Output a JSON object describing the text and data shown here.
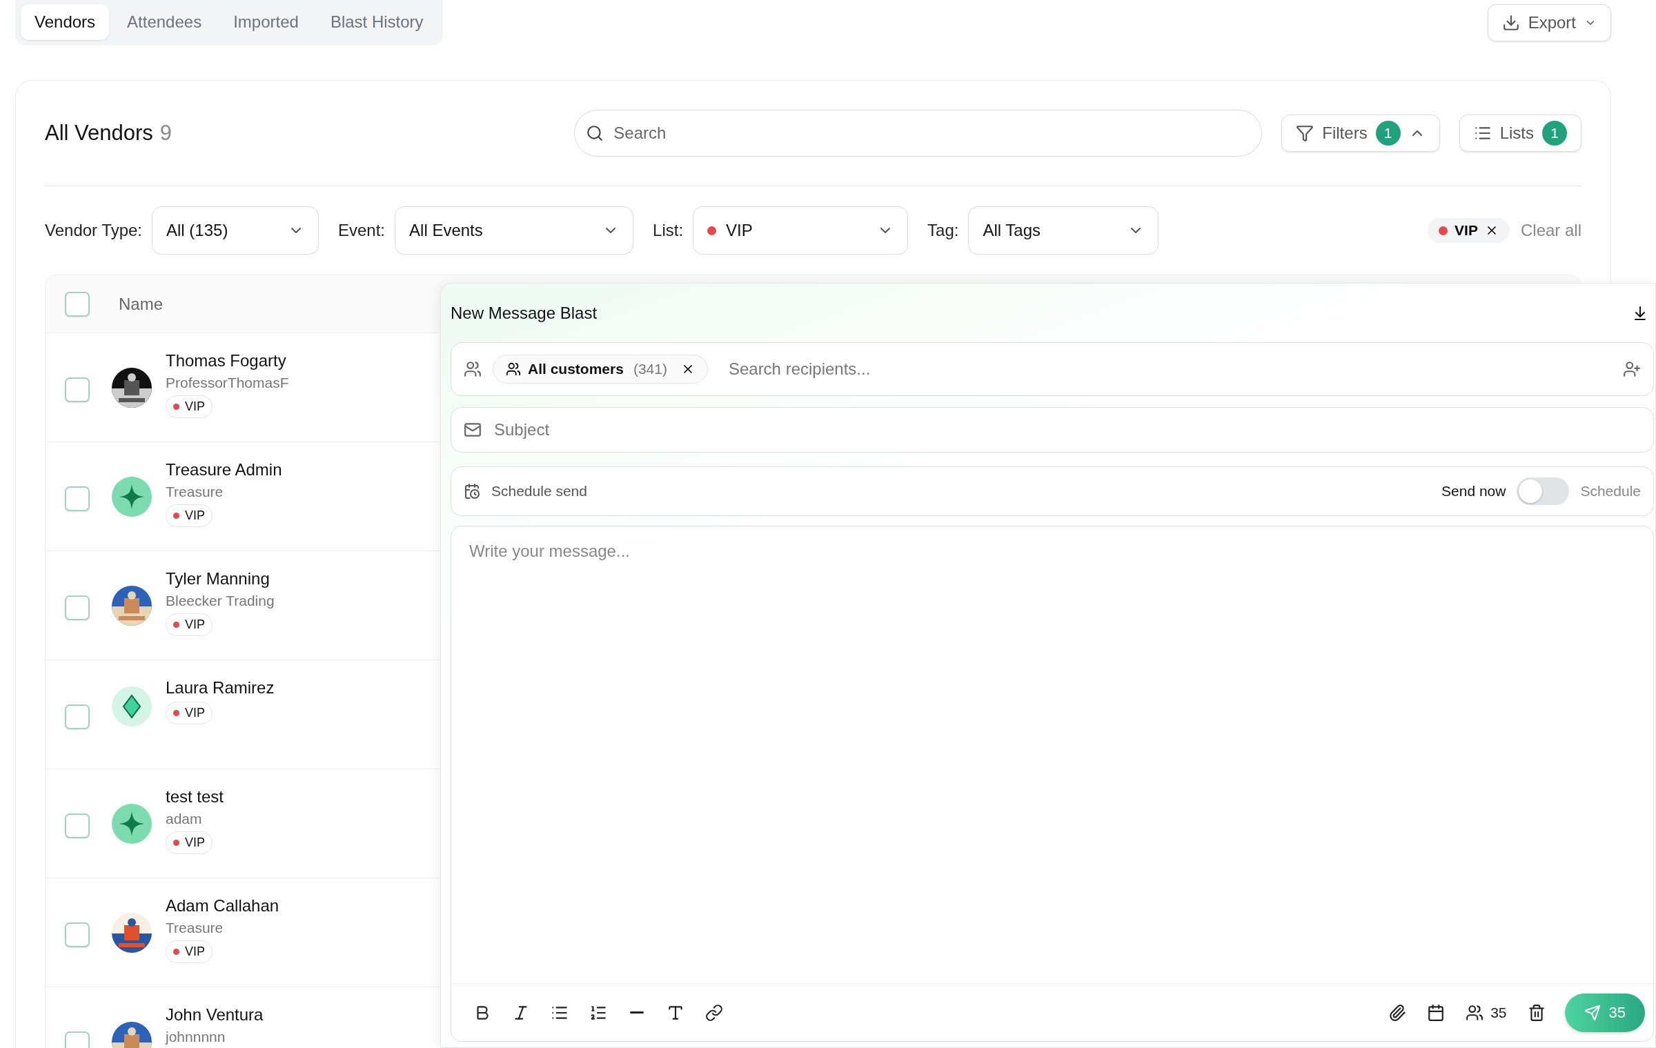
{
  "tabs": [
    {
      "label": "Vendors",
      "selected": true
    },
    {
      "label": "Attendees",
      "selected": false
    },
    {
      "label": "Imported",
      "selected": false
    },
    {
      "label": "Blast History",
      "selected": false
    }
  ],
  "export_button": {
    "label": "Export"
  },
  "heading": {
    "title": "All Vendors",
    "count": "9"
  },
  "search": {
    "placeholder": "Search"
  },
  "filters_button": {
    "label": "Filters",
    "badge": "1",
    "expanded": true
  },
  "lists_button": {
    "label": "Lists",
    "badge": "1"
  },
  "filter_row": [
    {
      "label": "Vendor Type:",
      "value": "All (135)"
    },
    {
      "label": "Event:",
      "value": "All Events"
    },
    {
      "label": "List:",
      "value": "VIP",
      "color": "#e5484d"
    },
    {
      "label": "Tag:",
      "value": "All Tags"
    }
  ],
  "active_filters": [
    {
      "label": "VIP",
      "color": "#e5484d"
    }
  ],
  "clear_all": "Clear all",
  "table": {
    "header": {
      "label": "Name",
      "checked": false
    },
    "rows": [
      {
        "name": "Thomas Fogarty",
        "subtitle": "ProfessorThomasF",
        "tag": {
          "label": "VIP",
          "color": "#e5484d"
        },
        "checked": false
      },
      {
        "name": "Treasure Admin",
        "subtitle": "Treasure",
        "avatar": {
          "kind": "sparkle"
        },
        "tag": {
          "label": "VIP",
          "color": "#e5484d"
        },
        "checked": false
      },
      {
        "name": "Tyler Manning",
        "subtitle": "Bleecker Trading",
        "tag": {
          "label": "VIP",
          "color": "#e5484d"
        },
        "checked": false
      },
      {
        "name": "Laura Ramirez",
        "avatar": {
          "kind": "diamond"
        },
        "tag": {
          "label": "VIP",
          "color": "#e5484d"
        },
        "checked": false
      },
      {
        "name": "test test",
        "subtitle": "adam",
        "avatar": {
          "kind": "sparkle"
        },
        "tag": {
          "label": "VIP",
          "color": "#e5484d"
        },
        "checked": false
      },
      {
        "name": "Adam Callahan",
        "subtitle": "Treasure",
        "tag": {
          "label": "VIP",
          "color": "#e5484d"
        },
        "checked": false
      },
      {
        "name": "John Ventura",
        "subtitle": "johnnnnn",
        "checked": false
      }
    ]
  },
  "message_panel": {
    "title": "New Message Blast",
    "recipients": {
      "chips": [
        {
          "label": "All customers",
          "count": "(341)"
        }
      ],
      "placeholder": "Search recipients..."
    },
    "subject": {
      "placeholder": "Subject"
    },
    "schedule": {
      "label": "Schedule send",
      "off_label": "Send now",
      "on_label": "Schedule",
      "on": false
    },
    "message": {
      "placeholder": "Write your message..."
    },
    "recipient_count": "35",
    "send_button": {
      "label": "35"
    }
  }
}
